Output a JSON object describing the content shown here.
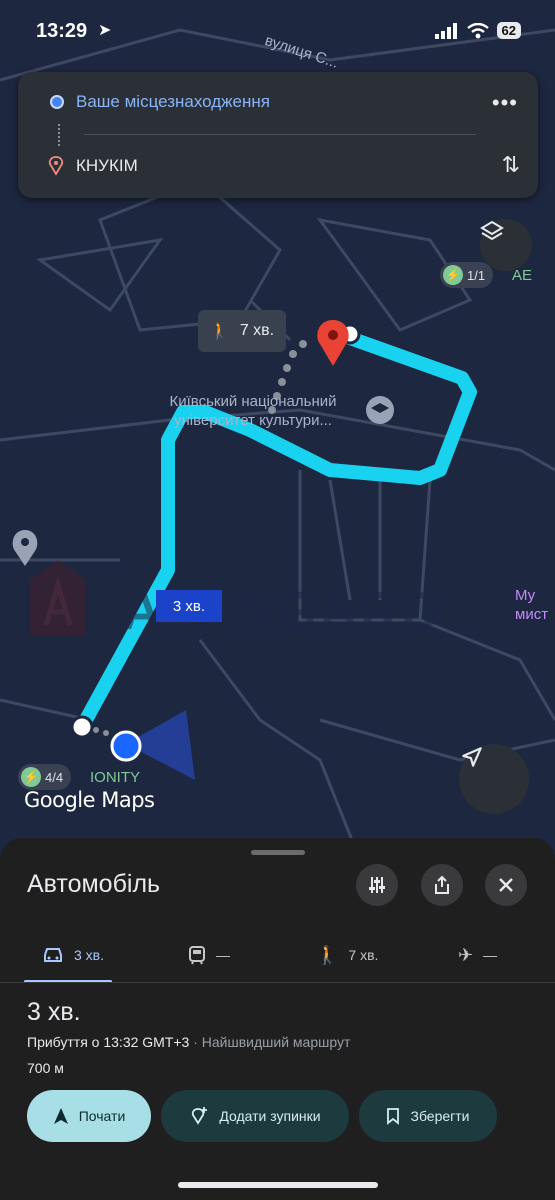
{
  "status_bar": {
    "time": "13:29",
    "battery": "62"
  },
  "map": {
    "street_name": "вулиця С...",
    "university_label": "Київський національний університет культури...",
    "walk_time": "7 хв.",
    "drive_time": "3 хв.",
    "charger_top": "1/1",
    "charger_top_tag": "АЕ",
    "charger_bottom": "4/4",
    "ionity_label": "IONITY",
    "right_label": "Му мист",
    "google_logo": "Google Maps",
    "route_color": "#19d2f0"
  },
  "route_card": {
    "origin": "Ваше місцезнаходження",
    "destination": "КНУКІМ"
  },
  "sheet": {
    "title": "Автомобіль",
    "tabs": [
      {
        "label": "3 хв.",
        "icon": "car-icon"
      },
      {
        "label": "—",
        "icon": "transit-icon"
      },
      {
        "label": "7 хв.",
        "icon": "walk-icon"
      },
      {
        "label": "—",
        "icon": "plane-icon"
      }
    ],
    "duration": "3 хв.",
    "arrival": "Прибуття о 13:32 GMT+3",
    "arrival_note": "· Найшвидший маршрут",
    "distance": "700 м",
    "actions": {
      "start": "Почати",
      "add_stops": "Додати зупинки",
      "save": "Зберегти"
    }
  }
}
